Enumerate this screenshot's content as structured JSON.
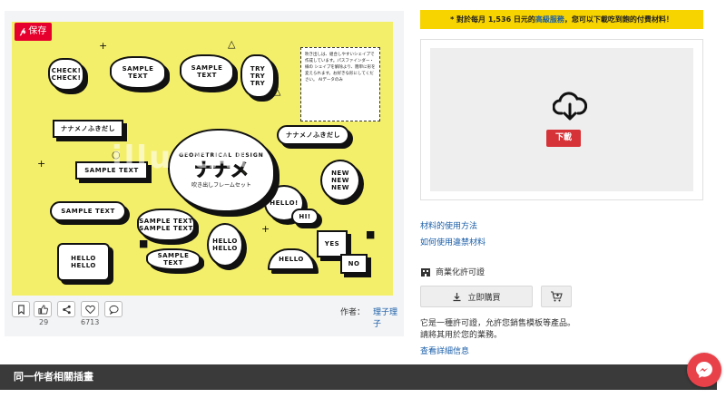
{
  "preview": {
    "save_label": "保存",
    "watermark": "illustAC",
    "bubbles": {
      "check": "CHECK! CHECK!",
      "sample1": "SAMPLE TEXT",
      "sample2": "SAMPLE TEXT",
      "try": "TRY TRY TRY",
      "nanamei": "ナナメノふきだし",
      "nanamei2": "ナナメノふきだし",
      "sample3": "SAMPLE TEXT",
      "sample4": "SAMPLE TEXT",
      "sample5": "SAMPLE TEXT SAMPLE TEXT",
      "sample6": "SAMPLE TEXT",
      "hello1": "HELLO HELLO",
      "hello2": "HELLO HELLO",
      "hello3": "HELLO!",
      "hello4": "HELLO",
      "hi": "HI!",
      "new": "NEW NEW NEW",
      "yes": "YES",
      "no": "NO"
    },
    "center": {
      "top": "GEOMETRICAL DESIGN",
      "title": "ナナメ",
      "subtitle": "吹き出しフレームセット"
    },
    "textbox": "吹き出しは、組合しやすいシェイプで作成しています。パスファインダー・線の シェイプを解除より、簡単に形を変えられます。お好きな形にしてください。 AIデータのみ"
  },
  "actions": {
    "likes": "29",
    "favorites": "6713",
    "author_label": "作者：",
    "author_name": "理子理子"
  },
  "right": {
    "notice_prefix": "* 對於每月 1,536 日元的",
    "notice_link": "高級服務",
    "notice_suffix": "，您可以下載吃到飽的付費材料！",
    "download_label": "下載",
    "link_usage": "材料的使用方法",
    "link_violation": "如何使用違禁材料",
    "license_title": "商業化許可證",
    "buy_label": "立即購買",
    "desc_line1": "它是一種許可證，允許您銷售模板等產品。",
    "desc_line2": "請將其用於您的業務。",
    "details_link": "查看詳細信息"
  },
  "related": {
    "title": "同一作者相關插畫"
  },
  "colors": {
    "accent_red": "#e6002d",
    "notice_yellow": "#f7d300",
    "artwork_yellow": "#f4ef6b",
    "link_blue": "#1a5ea8"
  }
}
